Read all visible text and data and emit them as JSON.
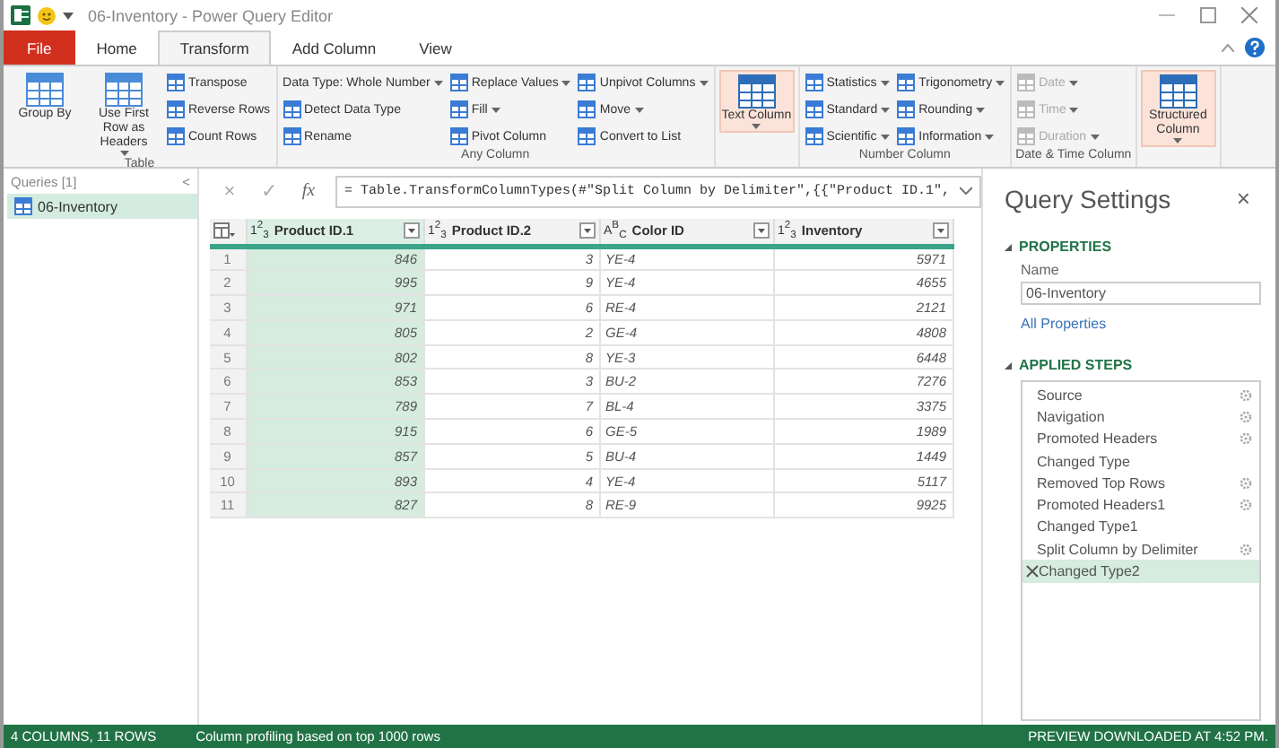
{
  "window": {
    "title": "06-Inventory - Power Query Editor"
  },
  "tabs": [
    {
      "label": "File",
      "kind": "file",
      "selected": false
    },
    {
      "label": "Home",
      "kind": "tab",
      "selected": false
    },
    {
      "label": "Transform",
      "kind": "tab",
      "selected": true
    },
    {
      "label": "Add Column",
      "kind": "tab",
      "selected": false
    },
    {
      "label": "View",
      "kind": "tab",
      "selected": false
    }
  ],
  "ribbon": [
    {
      "label": "Table",
      "columns": [
        [
          {
            "kind": "large",
            "label": "Group By",
            "dropdown": false,
            "highlighted": false,
            "disabled": false
          }
        ],
        [
          {
            "kind": "large",
            "label": "Use First Row as Headers",
            "dropdown": true,
            "highlighted": false,
            "disabled": false
          }
        ],
        [
          {
            "kind": "small",
            "label": "Transpose",
            "dropdown": false,
            "disabled": false
          },
          {
            "kind": "small",
            "label": "Reverse Rows",
            "dropdown": false,
            "disabled": false
          },
          {
            "kind": "small",
            "label": "Count Rows",
            "dropdown": false,
            "disabled": false
          }
        ]
      ]
    },
    {
      "label": "Any Column",
      "columns": [
        [
          {
            "kind": "small",
            "label": "Data Type: Whole Number",
            "dropdown": true,
            "disabled": false,
            "noicon": true
          },
          {
            "kind": "small",
            "label": "Detect Data Type",
            "dropdown": false,
            "disabled": false
          },
          {
            "kind": "small",
            "label": "Rename",
            "dropdown": false,
            "disabled": false
          }
        ],
        [
          {
            "kind": "small",
            "label": "Replace Values",
            "dropdown": true,
            "disabled": false
          },
          {
            "kind": "small",
            "label": "Fill",
            "dropdown": true,
            "disabled": false
          },
          {
            "kind": "small",
            "label": "Pivot Column",
            "dropdown": false,
            "disabled": false
          }
        ],
        [
          {
            "kind": "small",
            "label": "Unpivot Columns",
            "dropdown": true,
            "disabled": false
          },
          {
            "kind": "small",
            "label": "Move",
            "dropdown": true,
            "disabled": false
          },
          {
            "kind": "small",
            "label": "Convert to List",
            "dropdown": false,
            "disabled": false
          }
        ]
      ]
    },
    {
      "columns": [
        [
          {
            "kind": "large",
            "label": "Text Column",
            "dropdown": true,
            "highlighted": true,
            "disabled": false
          }
        ]
      ]
    },
    {
      "label": "Number Column",
      "columns": [
        [
          {
            "kind": "small",
            "label": "Statistics",
            "dropdown": true,
            "disabled": false
          },
          {
            "kind": "small",
            "label": "Standard",
            "dropdown": true,
            "disabled": false
          },
          {
            "kind": "small",
            "label": "Scientific",
            "dropdown": true,
            "disabled": false
          }
        ],
        [
          {
            "kind": "small",
            "label": "Trigonometry",
            "dropdown": true,
            "disabled": false
          },
          {
            "kind": "small",
            "label": "Rounding",
            "dropdown": true,
            "disabled": false
          },
          {
            "kind": "small",
            "label": "Information",
            "dropdown": true,
            "disabled": false
          }
        ]
      ]
    },
    {
      "label": "Date & Time Column",
      "columns": [
        [
          {
            "kind": "small",
            "label": "Date",
            "dropdown": true,
            "disabled": true
          },
          {
            "kind": "small",
            "label": "Time",
            "dropdown": true,
            "disabled": true
          },
          {
            "kind": "small",
            "label": "Duration",
            "dropdown": true,
            "disabled": true
          }
        ]
      ]
    },
    {
      "columns": [
        [
          {
            "kind": "large",
            "label": "Structured Column",
            "dropdown": true,
            "highlighted": true,
            "disabled": false
          }
        ]
      ]
    }
  ],
  "queries": {
    "title": "Queries [1]",
    "collapse": "<",
    "items": [
      {
        "label": "06-Inventory",
        "selected": true
      }
    ]
  },
  "formula_bar": {
    "cancel": "×",
    "commit": "✓",
    "fx": "fx",
    "text": "= Table.TransformColumnTypes(#\"Split Column by Delimiter\",{{\"Product ID.1\","
  },
  "table": {
    "columns": [
      {
        "type": "1$^{2}$$_{3}$",
        "name": "Product ID.1",
        "kind": "number",
        "selected": true
      },
      {
        "type": "1$^{2}$$_{3}$",
        "name": "Product ID.2",
        "kind": "number",
        "selected": false
      },
      {
        "type": "A$^{B}$$_{C}$",
        "name": "Color ID",
        "kind": "text",
        "selected": false
      },
      {
        "type": "1$^{2}$$_{3}$",
        "name": "Inventory",
        "kind": "number",
        "selected": false
      }
    ],
    "rows": [
      {
        "number": "1",
        "cells": [
          "846",
          "3",
          "YE-4",
          "5971"
        ]
      },
      {
        "number": "2",
        "cells": [
          "995",
          "9",
          "YE-4",
          "4655"
        ]
      },
      {
        "number": "3",
        "cells": [
          "971",
          "6",
          "RE-4",
          "2121"
        ]
      },
      {
        "number": "4",
        "cells": [
          "805",
          "2",
          "GE-4",
          "4808"
        ]
      },
      {
        "number": "5",
        "cells": [
          "802",
          "8",
          "YE-3",
          "6448"
        ]
      },
      {
        "number": "6",
        "cells": [
          "853",
          "3",
          "BU-2",
          "7276"
        ]
      },
      {
        "number": "7",
        "cells": [
          "789",
          "7",
          "BL-4",
          "3375"
        ]
      },
      {
        "number": "8",
        "cells": [
          "915",
          "6",
          "GE-5",
          "1989"
        ]
      },
      {
        "number": "9",
        "cells": [
          "857",
          "5",
          "BU-4",
          "1449"
        ]
      },
      {
        "number": "10",
        "cells": [
          "893",
          "4",
          "YE-4",
          "5117"
        ]
      },
      {
        "number": "11",
        "cells": [
          "827",
          "8",
          "RE-9",
          "9925"
        ]
      }
    ]
  },
  "settings": {
    "title": "Query Settings",
    "close": "×",
    "properties_title": "PROPERTIES",
    "name_label": "Name",
    "name_value": "06-Inventory",
    "all_properties": "All Properties",
    "steps_title": "APPLIED STEPS",
    "steps": [
      {
        "label": "Source",
        "settings": true,
        "selected": false
      },
      {
        "label": "Navigation",
        "settings": true,
        "selected": false
      },
      {
        "label": "Promoted Headers",
        "settings": true,
        "selected": false
      },
      {
        "label": "Changed Type",
        "settings": false,
        "selected": false
      },
      {
        "label": "Removed Top Rows",
        "settings": true,
        "selected": false
      },
      {
        "label": "Promoted Headers1",
        "settings": true,
        "selected": false
      },
      {
        "label": "Changed Type1",
        "settings": false,
        "selected": false
      },
      {
        "label": "Split Column by Delimiter",
        "settings": true,
        "selected": false
      },
      {
        "label": "Changed Type2",
        "settings": false,
        "selected": true
      }
    ]
  },
  "status_bar": {
    "left": "4 COLUMNS, 11 ROWS",
    "middle": "Column profiling based on top 1000 rows",
    "right": "PREVIEW DOWNLOADED AT 4:52 PM."
  }
}
